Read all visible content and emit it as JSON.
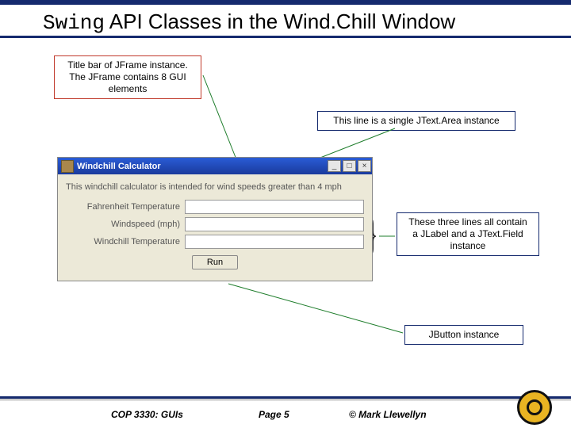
{
  "title_mono": "Swing",
  "title_rest": " API Classes in the Wind.Chill Window",
  "callouts": {
    "titlebar": "Title bar of JFrame instance. The JFrame contains 8 GUI elements",
    "textarea": "This line is a single JText.Area instance",
    "three_lines": "These three lines all contain a JLabel and a JText.Field instance",
    "button": "JButton instance"
  },
  "window": {
    "title": "Windchill Calculator",
    "description": "This windchill calculator is intended for wind speeds greater than 4 mph",
    "fields": [
      {
        "label": "Fahrenheit Temperature"
      },
      {
        "label": "Windspeed (mph)"
      },
      {
        "label": "Windchill Temperature"
      }
    ],
    "button_label": "Run",
    "controls": {
      "min": "_",
      "max": "□",
      "close": "×"
    }
  },
  "footer": {
    "course": "COP 3330:  GUIs",
    "page": "Page 5",
    "copyright": "© Mark Llewellyn"
  }
}
